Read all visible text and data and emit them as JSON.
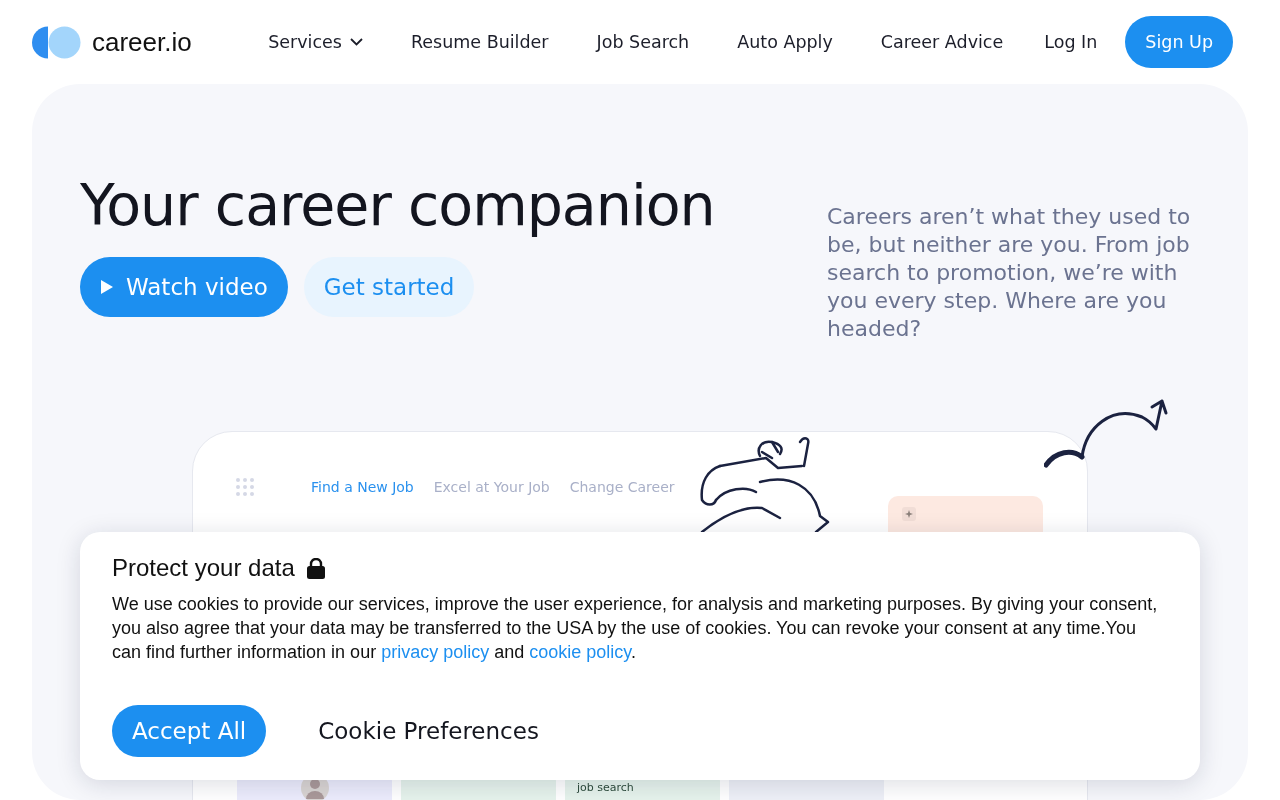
{
  "header": {
    "logo": "career.io",
    "nav": [
      {
        "label": "Services",
        "kind": "dropdown"
      },
      {
        "label": "Resume Builder",
        "kind": "link"
      },
      {
        "label": "Job Search",
        "kind": "link"
      },
      {
        "label": "Auto Apply",
        "kind": "link"
      },
      {
        "label": "Career Advice",
        "kind": "link"
      }
    ],
    "login": "Log In",
    "signup": "Sign Up"
  },
  "hero": {
    "heading": "Your career companion",
    "buttons": [
      {
        "label": "Watch video",
        "kind": "primary"
      },
      {
        "label": "Get started",
        "kind": "secondary"
      }
    ],
    "intro": "Careers aren’t what they used to be, but neither are you. From job search to promotion, we’re with you every step. Where are you headed?"
  },
  "preview": {
    "tabs": [
      {
        "label": "Find a New Job",
        "selected": true
      },
      {
        "label": "Excel at Your Job",
        "selected": false
      },
      {
        "label": "Change Career",
        "selected": false
      }
    ],
    "tiles": [
      {
        "kind": "avatar",
        "color": "#ececfc"
      },
      {
        "kind": "plain",
        "color": "#e6f3ec"
      },
      {
        "kind": "text",
        "color": "#e6f3ec",
        "text": "job search"
      },
      {
        "kind": "plain",
        "color": "#eef0f7"
      }
    ]
  },
  "cookie": {
    "title": "Protect your data",
    "text_parts": [
      {
        "kind": "text",
        "text": "We use cookies to provide our services, improve the user experience, for analysis and marketing purposes. By giving your consent, you also agree that your data may be transferred to the USA by the use of cookies. You can revoke your consent at any time.You can find further information in our "
      },
      {
        "kind": "link",
        "text": "privacy policy"
      },
      {
        "kind": "text",
        "text": " and "
      },
      {
        "kind": "link",
        "text": "cookie policy"
      },
      {
        "kind": "text",
        "text": "."
      }
    ],
    "buttons": [
      {
        "label": "Accept All",
        "kind": "primary"
      },
      {
        "label": "Cookie Preferences",
        "kind": "plain"
      }
    ]
  }
}
